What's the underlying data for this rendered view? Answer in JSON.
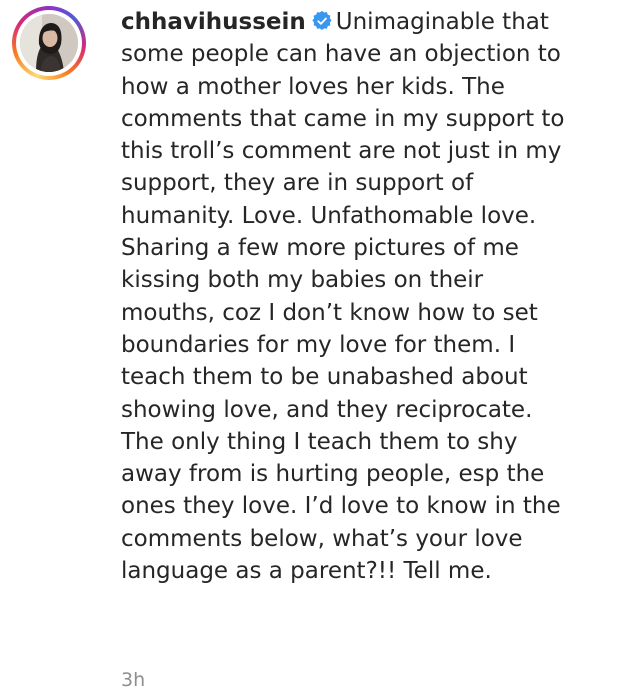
{
  "post": {
    "username": "chhavihussein",
    "verified_icon": "verified-badge-icon",
    "caption_lines": [
      "Unimaginable that",
      "some people can have an objection to",
      "how a mother loves her kids. The",
      "comments that came in my support to",
      "this troll’s comment are not just in my",
      "support, they are in support of",
      "humanity. Love. Unfathomable love.",
      "Sharing a few more pictures of me",
      "kissing both my babies on their",
      "mouths, coz I don’t know how to set",
      "boundaries for my love for them. I",
      "teach them to be unabashed about",
      "showing love, and they reciprocate.",
      "The only thing I teach them to shy",
      "away from is hurting people, esp the",
      "ones they love. I’d love to know in the",
      "comments below, what’s your love",
      "language as a parent?!! Tell me."
    ],
    "timestamp": "3h"
  },
  "colors": {
    "text": "#262626",
    "muted": "#8e8e8e",
    "verified": "#3897f0"
  }
}
